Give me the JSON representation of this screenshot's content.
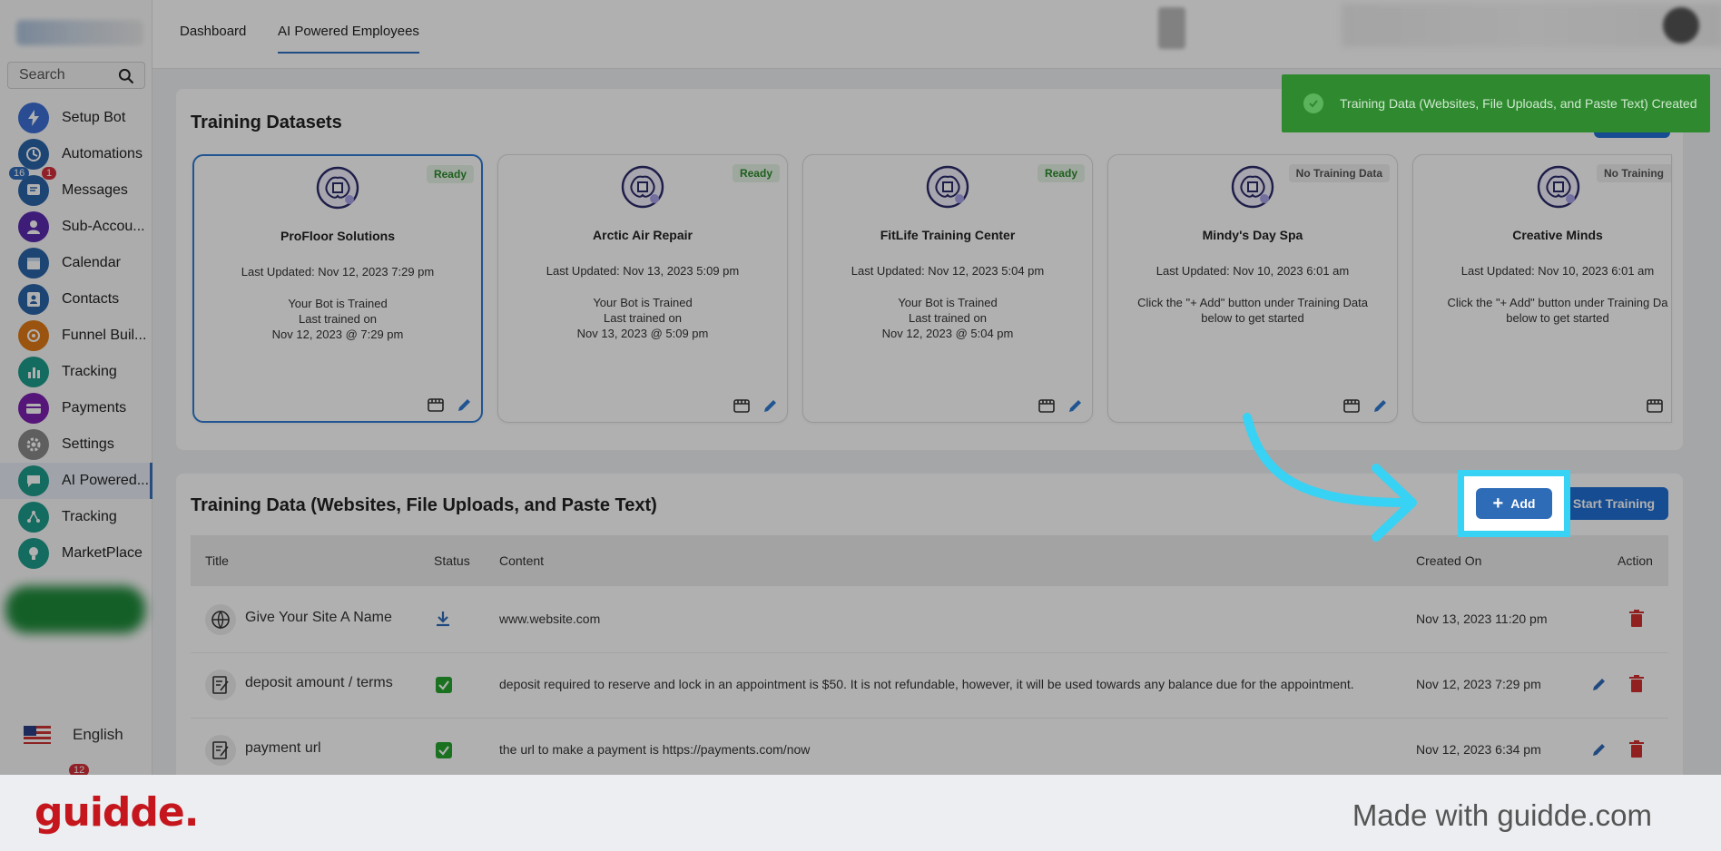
{
  "sidebar": {
    "search_placeholder": "Search",
    "items": [
      {
        "label": "Setup Bot",
        "icon": "lightning-icon",
        "color": "#3c6fd6"
      },
      {
        "label": "Automations",
        "icon": "automations-icon",
        "color": "#2a64a8"
      },
      {
        "label": "Messages",
        "icon": "messages-icon",
        "color": "#2a64a8"
      },
      {
        "label": "Sub-Accou...",
        "icon": "user-icon",
        "color": "#5b2bb0"
      },
      {
        "label": "Calendar",
        "icon": "calendar-icon",
        "color": "#2a64a8"
      },
      {
        "label": "Contacts",
        "icon": "contacts-icon",
        "color": "#2a64a8"
      },
      {
        "label": "Funnel Buil...",
        "icon": "funnel-icon",
        "color": "#e07a18"
      },
      {
        "label": "Tracking",
        "icon": "bar-chart-icon",
        "color": "#1e9c8c"
      },
      {
        "label": "Payments",
        "icon": "card-icon",
        "color": "#7c1fb0"
      },
      {
        "label": "Settings",
        "icon": "gear-icon",
        "color": "#8a8a8a"
      },
      {
        "label": "AI Powered...",
        "icon": "chat-icon",
        "color": "#1e9c8c"
      },
      {
        "label": "Tracking",
        "icon": "network-icon",
        "color": "#1e9c8c"
      },
      {
        "label": "MarketPlace",
        "icon": "bulb-icon",
        "color": "#1e9c8c"
      }
    ],
    "messages_badge_count": "1",
    "messages_badge_left": "16",
    "footer_badge": "12",
    "language": "English"
  },
  "tabs": [
    {
      "label": "Dashboard"
    },
    {
      "label": "AI Powered Employees"
    }
  ],
  "datasets": {
    "title": "Training Datasets",
    "cards": [
      {
        "name": "ProFloor Solutions",
        "status": "Ready",
        "updated": "Last Updated: Nov 12, 2023 7:29 pm",
        "line1": "Your Bot is Trained",
        "line2": "Last trained on",
        "line3": "Nov 12, 2023 @ 7:29 pm"
      },
      {
        "name": "Arctic Air Repair",
        "status": "Ready",
        "updated": "Last Updated: Nov 13, 2023 5:09 pm",
        "line1": "Your Bot is Trained",
        "line2": "Last trained on",
        "line3": "Nov 13, 2023 @ 5:09 pm"
      },
      {
        "name": "FitLife Training Center",
        "status": "Ready",
        "updated": "Last Updated: Nov 12, 2023 5:04 pm",
        "line1": "Your Bot is Trained",
        "line2": "Last trained on",
        "line3": "Nov 12, 2023 @ 5:04 pm"
      },
      {
        "name": "Mindy's Day Spa",
        "status": "No Training Data",
        "updated": "Last Updated: Nov 10, 2023 6:01 am",
        "line1": "Click the \"+ Add\" button under Training Data",
        "line2": "below to get started",
        "line3": ""
      },
      {
        "name": "Creative Minds",
        "status": "No Training",
        "updated": "Last Updated: Nov 10, 2023 6:01 am",
        "line1": "Click the \"+ Add\" button under Training Da",
        "line2": "below to get started",
        "line3": ""
      }
    ]
  },
  "training_data": {
    "title": "Training Data (Websites, File Uploads, and Paste Text)",
    "add_label": "Add",
    "start_label": "Start Training",
    "columns": {
      "title": "Title",
      "status": "Status",
      "content": "Content",
      "created": "Created On",
      "action": "Action"
    },
    "rows": [
      {
        "title": "Give Your Site A Name",
        "status": "download",
        "content": "www.website.com",
        "created": "Nov 13, 2023 11:20 pm",
        "editable": false
      },
      {
        "title": "deposit amount / terms",
        "status": "done",
        "content": "deposit required to reserve and lock in an appointment is $50. It is not refundable, however, it will be used towards any balance due for the appointment.",
        "created": "Nov 12, 2023 7:29 pm",
        "editable": true
      },
      {
        "title": "payment url",
        "status": "done",
        "content": "the url to make a payment is https://payments.com/now",
        "created": "Nov 12, 2023 6:34 pm",
        "editable": true
      }
    ]
  },
  "toast": {
    "message": "Training Data (Websites, File Uploads, and Paste Text) Created"
  },
  "footer": {
    "brand": "guidde.",
    "made_with": "Made with guidde.com"
  },
  "colors": {
    "accent": "#2f6cb8",
    "highlight": "#38d2f4",
    "toast": "#2f8a2f",
    "brand": "#c4161c"
  }
}
